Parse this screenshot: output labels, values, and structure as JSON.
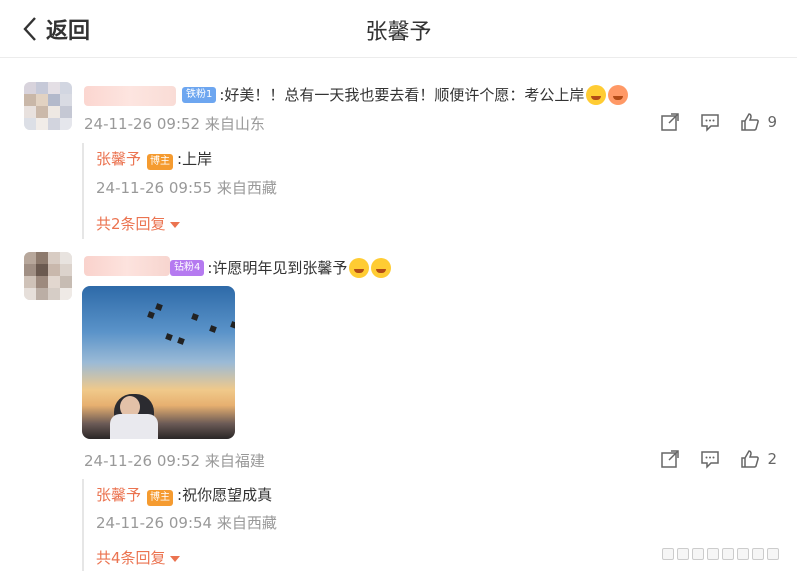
{
  "header": {
    "back_label": "返回",
    "title": "张馨予"
  },
  "comments": [
    {
      "badge": "铁粉1",
      "badge_color": "#6da6f0",
      "text": ":好美！！总有一天我也要去看！顺便许个愿：考公上岸",
      "time": "24-11-26 09:52 来自山东",
      "likes": "9",
      "replies": [
        {
          "name": "张馨予",
          "badge": "博主",
          "text": ":上岸",
          "time": "24-11-26 09:55 来自西藏"
        }
      ],
      "more_label": "共2条回复"
    },
    {
      "badge": "钻粉4",
      "badge_color": "#b57af0",
      "text": ":许愿明年见到张馨予",
      "time": "24-11-26 09:52 来自福建",
      "likes": "2",
      "replies": [
        {
          "name": "张馨予",
          "badge": "博主",
          "text": ":祝你愿望成真",
          "time": "24-11-26 09:54 来自西藏"
        }
      ],
      "more_label": "共4条回复"
    }
  ],
  "icons": {
    "back": "chevron-left-icon",
    "share": "share-icon",
    "comment": "comment-icon",
    "like": "thumbs-up-icon",
    "emoji": "emoji-icon"
  },
  "colors": {
    "accent": "#eb7350",
    "muted": "#999999",
    "blogger_badge": "#f59b30"
  }
}
